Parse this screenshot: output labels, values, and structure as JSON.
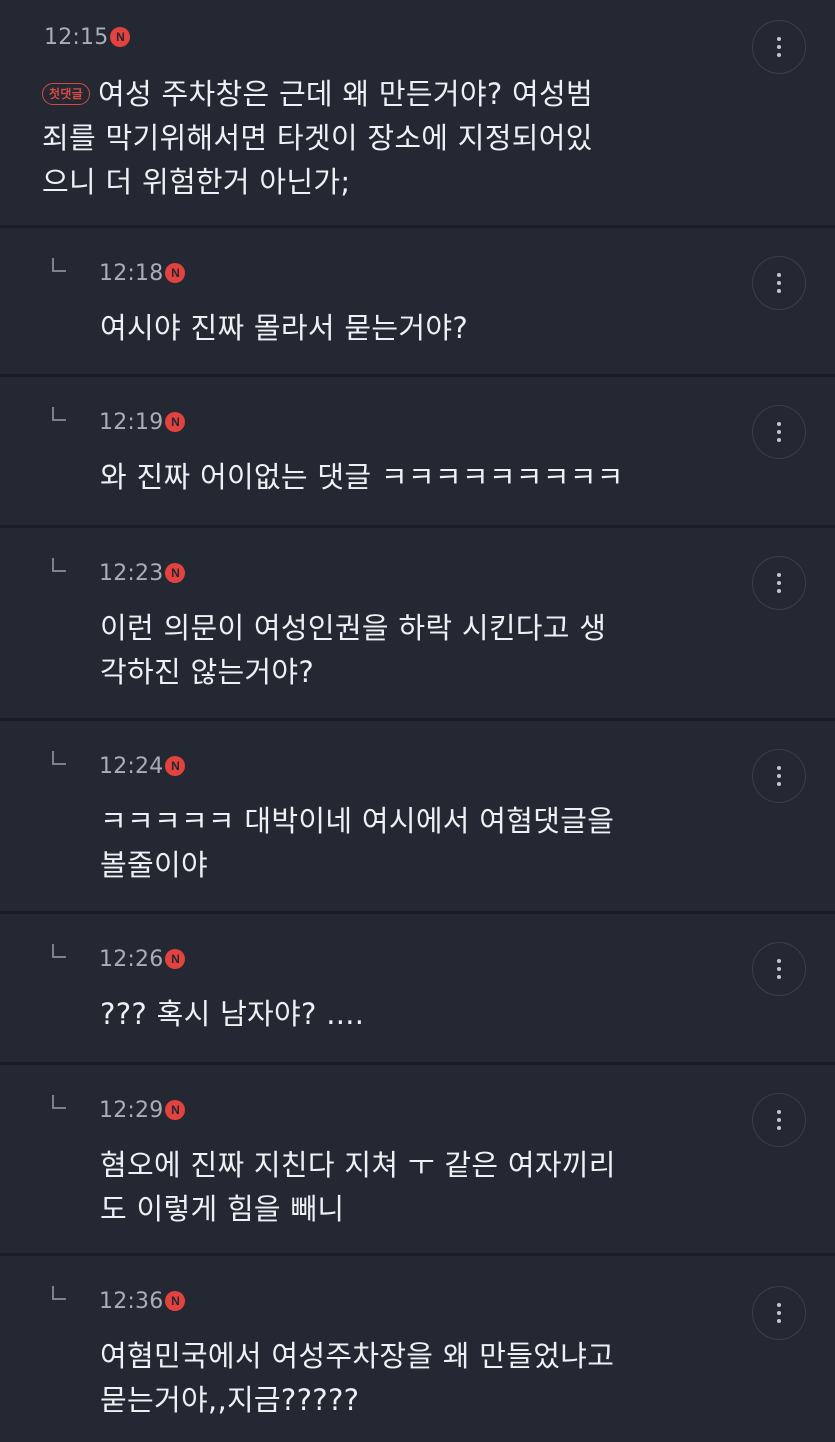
{
  "comments": [
    {
      "time": "12:15",
      "badge": "N",
      "first_label": "첫댓글",
      "text": "여성 주차창은 근데 왜 만든거야? 여성범\n죄를 막기위해서면 타겟이 장소에 지정되어있\n으니 더 위험한거 아닌가;"
    },
    {
      "time": "12:18",
      "badge": "N",
      "text": "여시야 진짜 몰라서 묻는거야?"
    },
    {
      "time": "12:19",
      "badge": "N",
      "text": "와 진짜 어이없는 댓글 ㅋㅋㅋㅋㅋㅋㅋㅋㅋ"
    },
    {
      "time": "12:23",
      "badge": "N",
      "text": "이런 의문이 여성인권을 하락 시킨다고 생\n각하진 않는거야?"
    },
    {
      "time": "12:24",
      "badge": "N",
      "text": "ㅋㅋㅋㅋㅋ 대박이네 여시에서 여혐댓글을\n볼줄이야"
    },
    {
      "time": "12:26",
      "badge": "N",
      "text": "??? 혹시 남자야? ...."
    },
    {
      "time": "12:29",
      "badge": "N",
      "text": "혐오에 진짜 지친다 지쳐 ㅜ 같은 여자끼리\n도 이렇게 힘을 빼니"
    },
    {
      "time": "12:36",
      "badge": "N",
      "text": "여혐민국에서 여성주차장을 왜 만들었냐고\n묻는거야,,지금?????"
    }
  ]
}
